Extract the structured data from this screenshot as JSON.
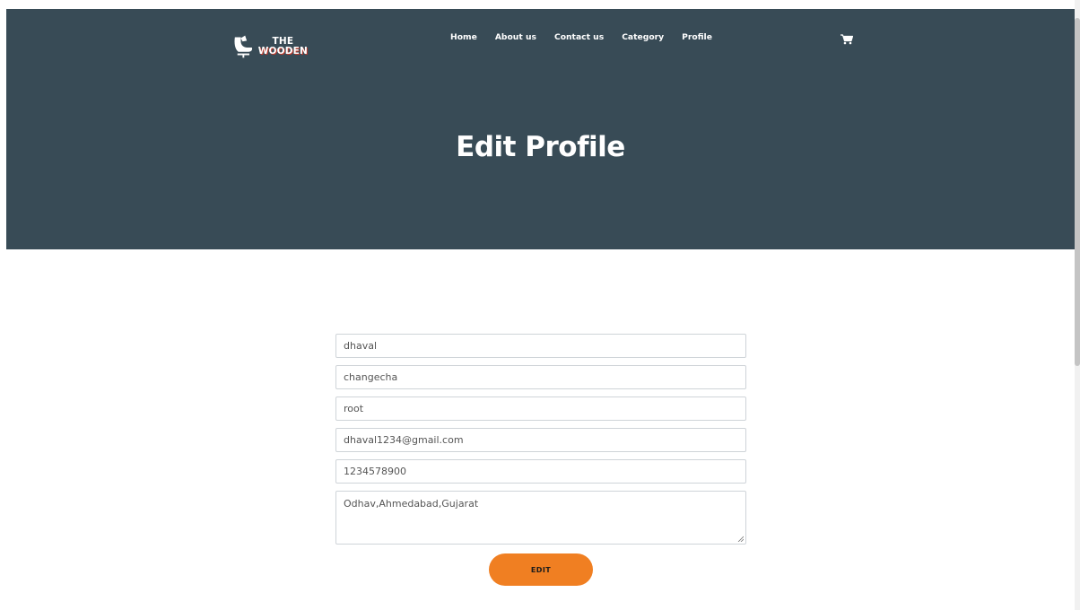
{
  "brand": {
    "line1": "THE",
    "line2": "WOODEN"
  },
  "nav": {
    "items": [
      {
        "label": "Home"
      },
      {
        "label": "About us"
      },
      {
        "label": "Contact us"
      },
      {
        "label": "Category"
      },
      {
        "label": "Profile"
      }
    ],
    "cart_icon": "cart-icon"
  },
  "hero": {
    "title": "Edit Profile"
  },
  "form": {
    "first_name": "dhaval",
    "last_name": "changecha",
    "username": "root",
    "email": "dhaval1234@gmail.com",
    "phone": "1234578900",
    "address": "Odhav,Ahmedabad,Gujarat",
    "submit_label": "EDIT"
  },
  "colors": {
    "header_bg": "#384b56",
    "accent": "#f07f22",
    "text_on_dark": "#ffffff"
  }
}
